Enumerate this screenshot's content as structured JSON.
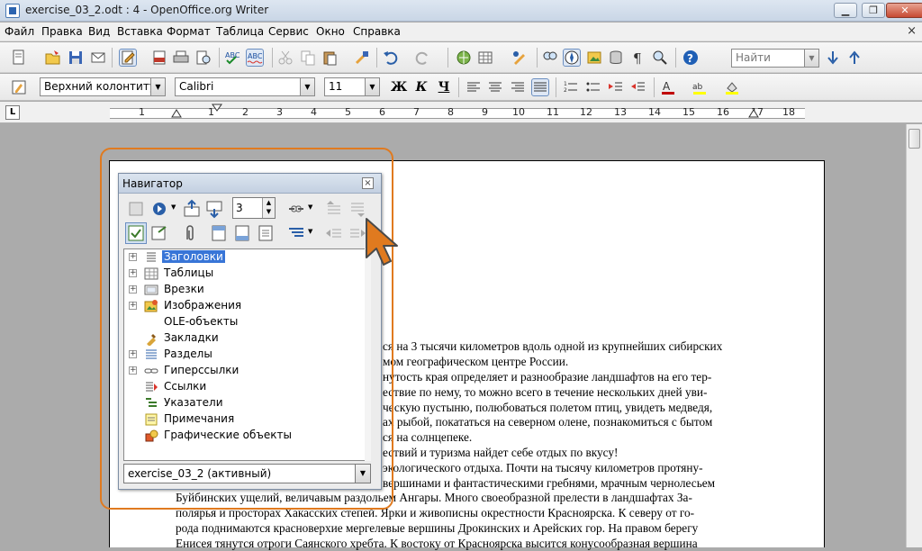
{
  "window": {
    "title": "exercise_03_2.odt : 4 - OpenOffice.org Writer",
    "min": "▁",
    "max": "❐",
    "close": "✕"
  },
  "menu": [
    "Файл",
    "Правка",
    "Вид",
    "Вставка",
    "Формат",
    "Таблица",
    "Сервис",
    "Окно",
    "Справка"
  ],
  "menu_close": "×",
  "toolbar": {
    "find_placeholder": "Найти"
  },
  "format_bar": {
    "style": "Верхний колонтитул",
    "font": "Calibri",
    "size": "11",
    "bold": "Ж",
    "italic": "К",
    "underline": "Ч"
  },
  "ruler": {
    "tab_selector": "L",
    "ticks": [
      "1",
      "1",
      "2",
      "3",
      "4",
      "5",
      "6",
      "7",
      "8",
      "9",
      "10",
      "11",
      "12",
      "13",
      "14",
      "15",
      "16",
      "17",
      "18"
    ]
  },
  "navigator": {
    "title": "Навигатор",
    "close": "×",
    "spin_value": "3",
    "document": "exercise_03_2 (активный)",
    "items": [
      {
        "label": "Заголовки",
        "expandable": true,
        "active": true,
        "icon": "headings-icon"
      },
      {
        "label": "Таблицы",
        "expandable": true,
        "active": false,
        "icon": "tables-icon"
      },
      {
        "label": "Врезки",
        "expandable": true,
        "active": false,
        "icon": "frames-icon"
      },
      {
        "label": "Изображения",
        "expandable": true,
        "active": false,
        "icon": "images-icon"
      },
      {
        "label": "OLE-объекты",
        "expandable": false,
        "active": false,
        "icon": "ole-objects-icon"
      },
      {
        "label": "Закладки",
        "expandable": false,
        "active": false,
        "icon": "bookmarks-icon"
      },
      {
        "label": "Разделы",
        "expandable": true,
        "active": false,
        "icon": "sections-icon"
      },
      {
        "label": "Гиперссылки",
        "expandable": true,
        "active": false,
        "icon": "hyperlinks-icon"
      },
      {
        "label": "Ссылки",
        "expandable": false,
        "active": false,
        "icon": "references-icon"
      },
      {
        "label": "Указатели",
        "expandable": false,
        "active": false,
        "icon": "indexes-icon"
      },
      {
        "label": "Примечания",
        "expandable": false,
        "active": false,
        "icon": "comments-icon"
      },
      {
        "label": "Графические объекты",
        "expandable": false,
        "active": false,
        "icon": "drawing-objects-icon"
      }
    ]
  },
  "document_text": {
    "lines_partial": [
      "ся на 3 тысячи километров вдоль одной из крупнейших сибирских",
      "мом географическом центре России.",
      "нутость края определяет и разнообразие ландшафтов на его тер-",
      "ествие по нему, то можно всего в течение нескольких дней уви-",
      "ческую пустыню, полюбоваться полетом птиц, увидеть медведя,",
      "ах рыбой, покататься на северном олене, познакомиться с бытом",
      "ся на солнцепеке.",
      "ествий и туризма найдет себе отдых по вкусу!",
      "экологического отдыха. Почти на тысячу километров протяну-",
      "вершинами и фантастическими гребнями, мрачным чернолесьем"
    ],
    "lines_full": [
      "Буйбинских ущелий, величавым раздольем Ангары. Много своеобразной прелести в ландшафтах За-",
      "полярья и просторах Хакасских степей. Ярки и живописны окрестности Красноярска. К северу от го-",
      "рода поднимаются красноверхие мергелевые вершины Дрокинских и Арейских гор. На правом берегу",
      "Енисея тянутся отроги Саянского хребта. К востоку от Красноярска высится конусообразная вершина"
    ]
  },
  "colors": {
    "highlight": "#e07a1f",
    "selection": "#3875d7",
    "cursor": "#e07a1f"
  }
}
